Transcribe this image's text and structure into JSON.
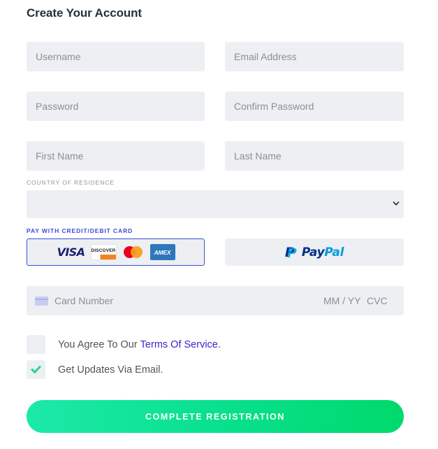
{
  "form": {
    "title": "Create Your Account",
    "username_placeholder": "Username",
    "email_placeholder": "Email Address",
    "password_placeholder": "Password",
    "confirm_password_placeholder": "Confirm Password",
    "first_name_placeholder": "First Name",
    "last_name_placeholder": "Last Name",
    "country_label": "COUNTRY OF RESIDENCE",
    "country_value": ""
  },
  "payment": {
    "section_label": "PAY WITH CREDIT/DEBIT CARD",
    "card_brands": [
      "VISA",
      "DISCOVER",
      "mastercard",
      "AMEX"
    ],
    "paypal_pay": "Pay",
    "paypal_pal": "Pal",
    "selected_method": "card",
    "card_number_placeholder": "Card Number",
    "expiry_placeholder": "MM / YY",
    "cvc_placeholder": "CVC"
  },
  "agreements": {
    "tos_prefix": "You Agree To Our",
    "tos_link": "Terms Of Service",
    "tos_suffix": ".",
    "tos_checked": false,
    "updates_label": "Get Updates Via Email.",
    "updates_checked": true
  },
  "submit_label": "COMPLETE REGISTRATION",
  "colors": {
    "accent": "#3b4cd6",
    "link": "#3b25c7",
    "success": "#00d96b",
    "field_bg": "#edeff2",
    "check": "#1fd992"
  }
}
